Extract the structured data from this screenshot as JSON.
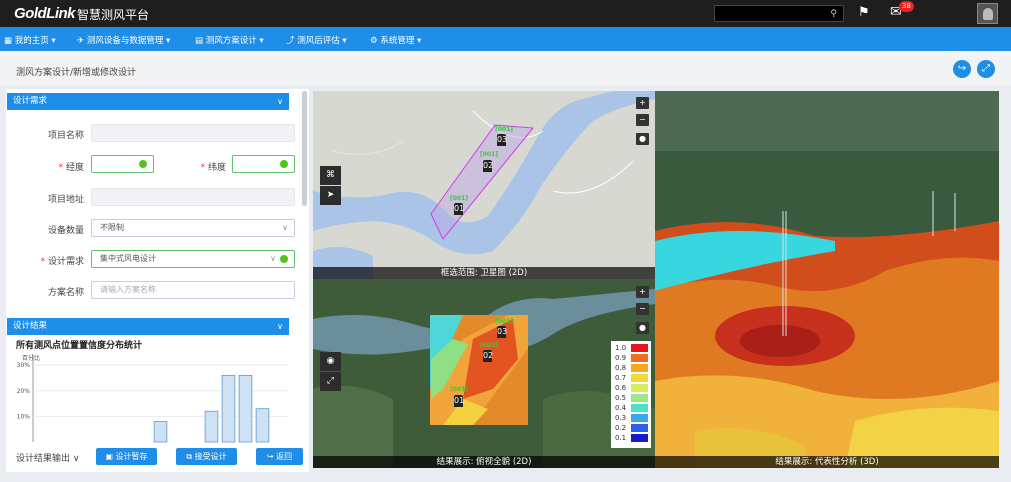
{
  "header": {
    "logo": "GoldLink",
    "title": "智慧测风平台",
    "badge_count": "38"
  },
  "search": {
    "placeholder": ""
  },
  "menu": [
    {
      "label": "我的主页 ▾",
      "icon": "grid-icon"
    },
    {
      "label": "测风设备与数据管理 ▾",
      "icon": "wind-device-icon"
    },
    {
      "label": "测风方案设计 ▾",
      "icon": "document-icon"
    },
    {
      "label": "测风后评估 ▾",
      "icon": "chart-line-icon"
    },
    {
      "label": "系统管理 ▾",
      "icon": "gear-icon"
    }
  ],
  "breadcrumb": "测风方案设计/新增或修改设计",
  "design": {
    "section_title": "设计需求",
    "fields": {
      "project_name_label": "项目名称",
      "longitude_label": "经度",
      "latitude_label": "纬度",
      "address_label": "项目地址",
      "device_count_label": "设备数量",
      "device_count_value": "不限制",
      "requirement_label": "设计需求",
      "requirement_value": "集中式风电设计",
      "scheme_name_label": "方案名称",
      "scheme_name_placeholder": "请输入方案名称"
    }
  },
  "results": {
    "section_title": "设计结果",
    "chart_title": "所有测风点位置置信度分布统计"
  },
  "chart_data": {
    "type": "bar",
    "ylabel": "百分比",
    "yticks": [
      "30%",
      "20%",
      "10%"
    ],
    "ylim": [
      0,
      32
    ],
    "values": [
      0,
      0,
      0,
      0,
      0,
      0,
      0,
      8,
      0,
      0,
      12,
      26,
      26,
      13,
      0
    ]
  },
  "footer": {
    "export_label": "设计结果输出 ∨",
    "save_label": "设计暂存",
    "accept_label": "接受设计",
    "back_label": "返回"
  },
  "maps": {
    "satellite_caption": "框选范围: 卫星图 (2D)",
    "overview_caption": "结果展示: 俯视全貌 (2D)",
    "analysis_caption": "结果展示: 代表性分析 (3D)",
    "turbines": [
      "01",
      "02",
      "03"
    ],
    "turbine_tag": "[001]"
  },
  "legend": {
    "labels": [
      "1.0",
      "0.9",
      "0.8",
      "0.7",
      "0.6",
      "0.5",
      "0.4",
      "0.3",
      "0.2",
      "0.1"
    ],
    "colors": [
      "#e8141e",
      "#f07020",
      "#f7a720",
      "#f3d83a",
      "#d9ee5e",
      "#9be884",
      "#48e2c8",
      "#38a8ee",
      "#2d5fe8",
      "#1a1ac8"
    ]
  },
  "colors": {
    "accent": "#1f8ee8",
    "topbar": "#1e1e1e"
  }
}
